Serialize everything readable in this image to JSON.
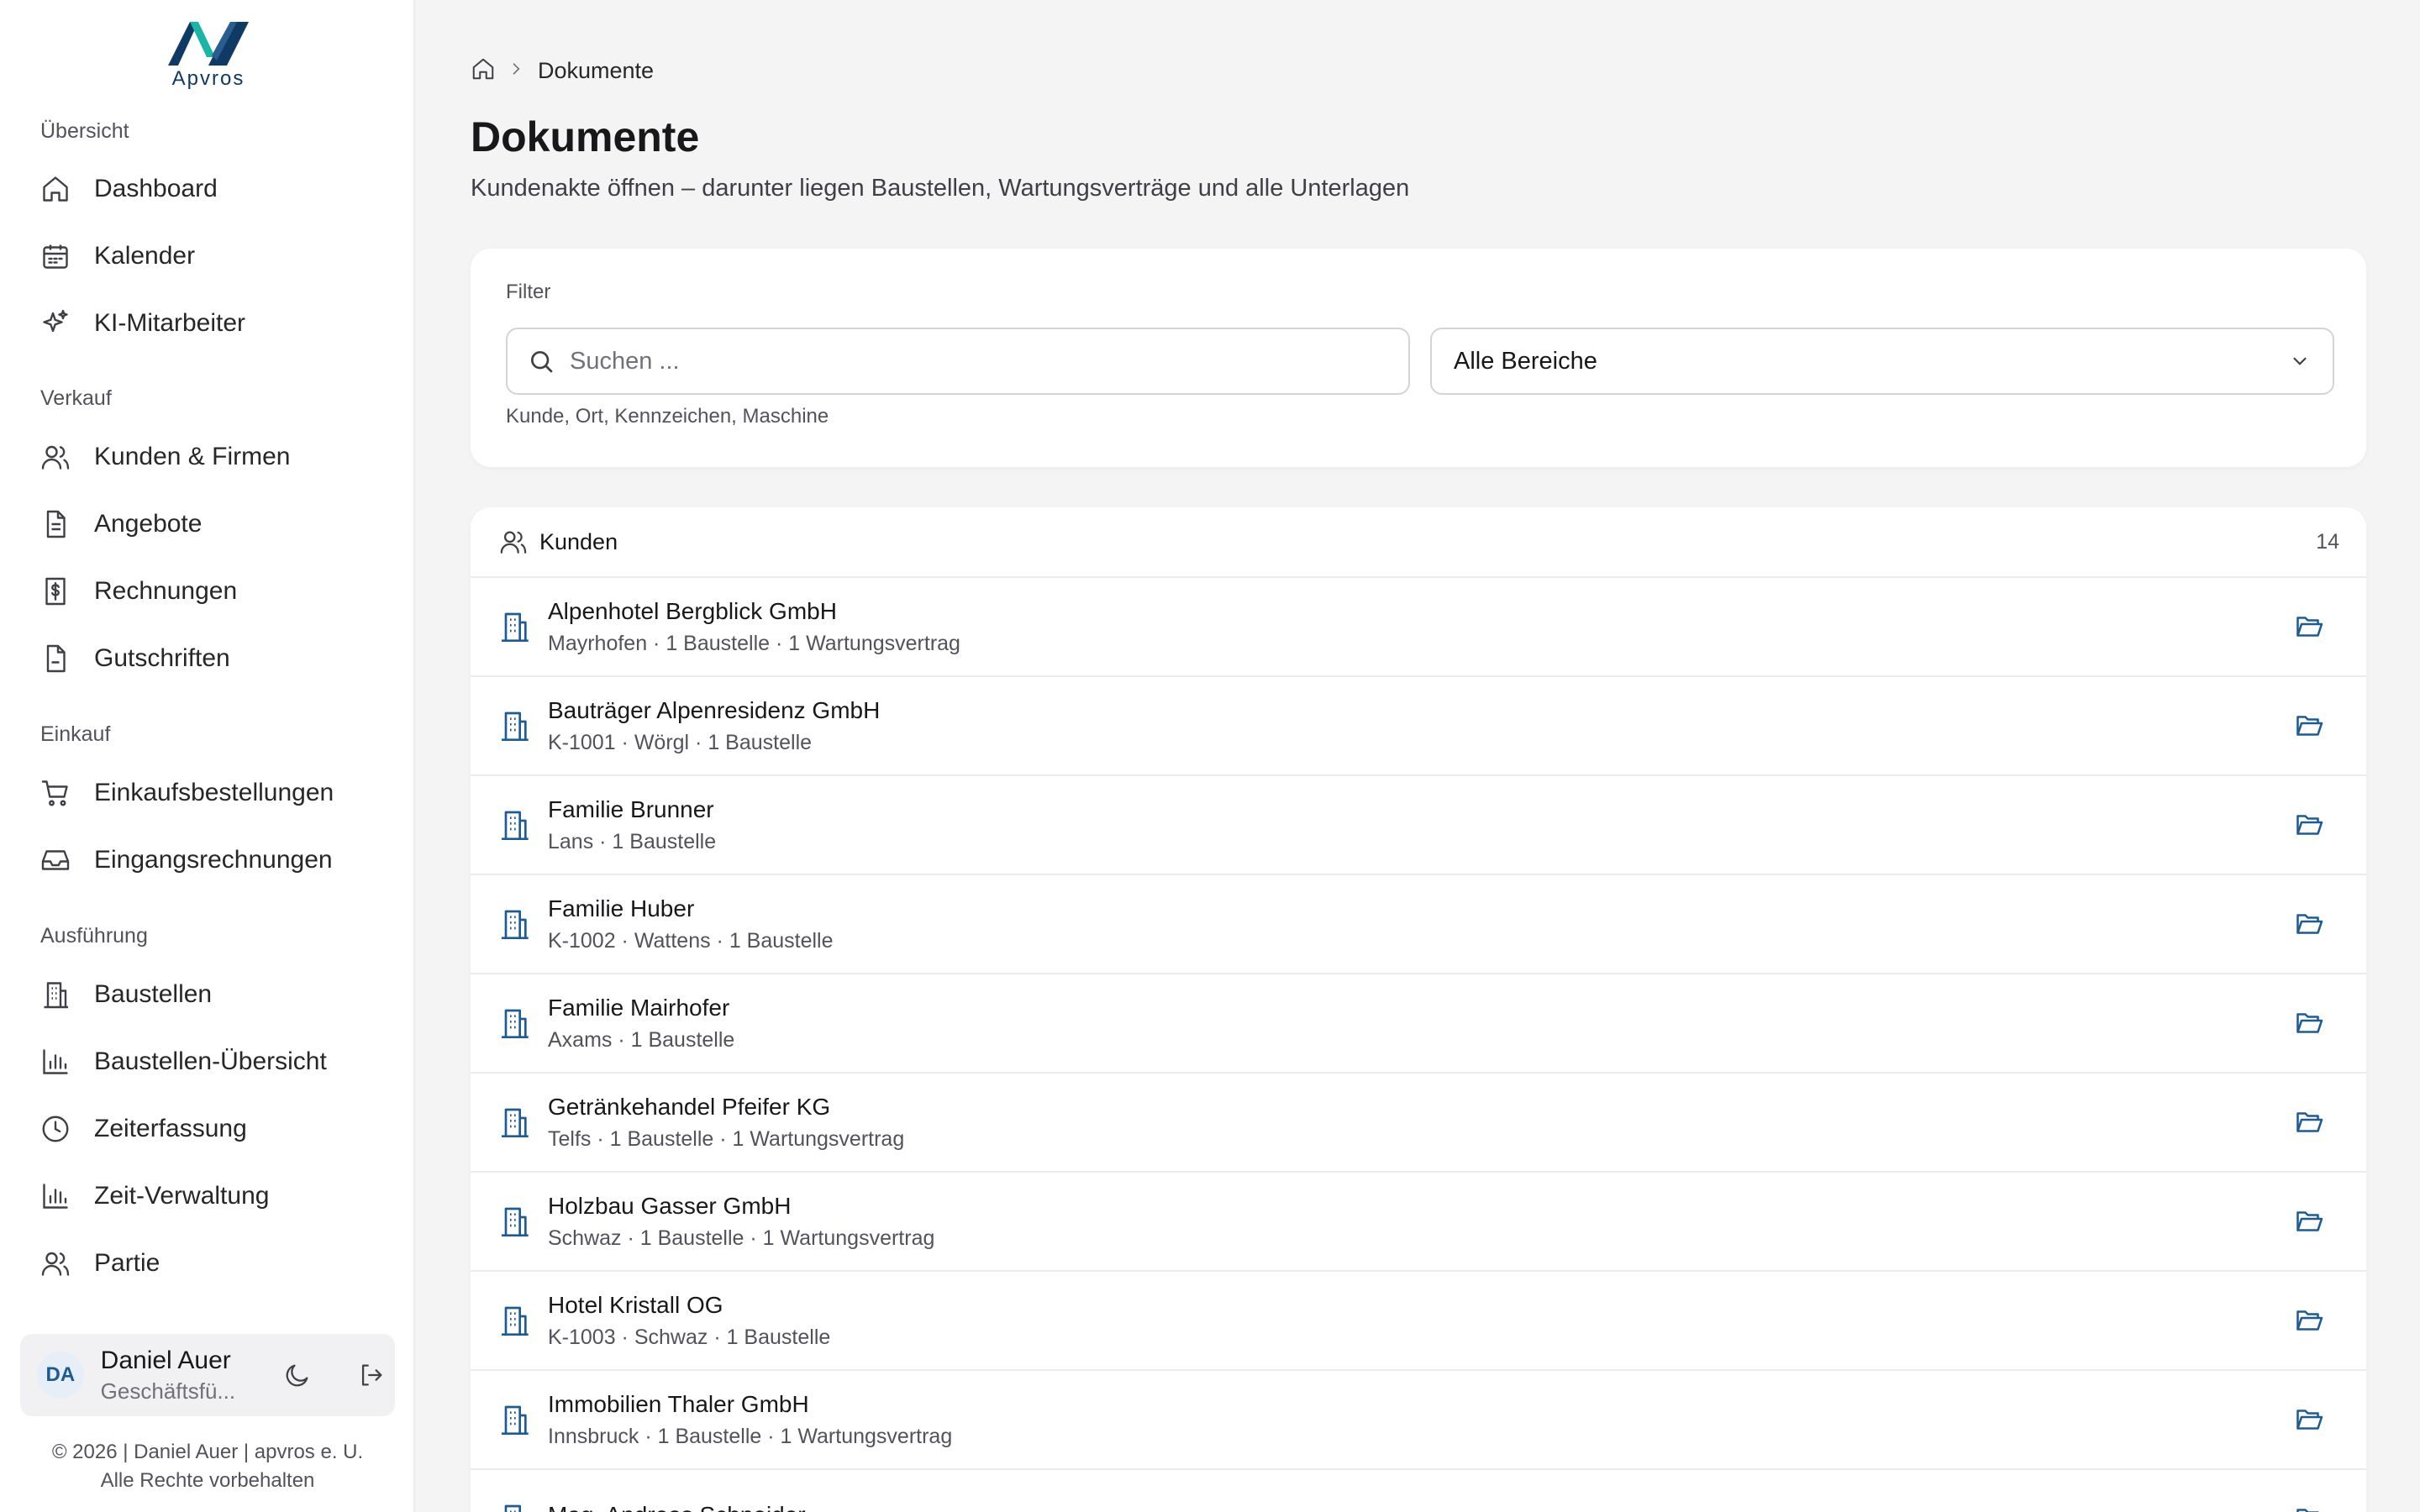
{
  "brand": {
    "logo_text": "Apvros"
  },
  "sidebar": {
    "sections": [
      {
        "title": "Übersicht",
        "items": [
          {
            "label": "Dashboard",
            "icon": "home-icon"
          },
          {
            "label": "Kalender",
            "icon": "calendar-icon"
          },
          {
            "label": "KI-Mitarbeiter",
            "icon": "sparkles-icon"
          }
        ]
      },
      {
        "title": "Verkauf",
        "items": [
          {
            "label": "Kunden & Firmen",
            "icon": "users-icon"
          },
          {
            "label": "Angebote",
            "icon": "document-icon"
          },
          {
            "label": "Rechnungen",
            "icon": "invoice-dollar-icon"
          },
          {
            "label": "Gutschriften",
            "icon": "file-icon"
          }
        ]
      },
      {
        "title": "Einkauf",
        "items": [
          {
            "label": "Einkaufsbestellungen",
            "icon": "cart-icon"
          },
          {
            "label": "Eingangsrechnungen",
            "icon": "inbox-icon"
          }
        ]
      },
      {
        "title": "Ausführung",
        "items": [
          {
            "label": "Baustellen",
            "icon": "building-icon"
          },
          {
            "label": "Baustellen-Übersicht",
            "icon": "bar-chart-icon"
          },
          {
            "label": "Zeiterfassung",
            "icon": "clock-icon"
          },
          {
            "label": "Zeit-Verwaltung",
            "icon": "bar-chart-icon"
          },
          {
            "label": "Partie",
            "icon": "user-group-icon"
          }
        ]
      }
    ]
  },
  "user": {
    "initials": "DA",
    "name": "Daniel Auer",
    "role": "Geschäftsfü..."
  },
  "footer": {
    "line1": "© 2026 | Daniel Auer | apvros e. U.",
    "line2": "Alle Rechte vorbehalten"
  },
  "breadcrumb": {
    "current": "Dokumente"
  },
  "page": {
    "title": "Dokumente",
    "subtitle": "Kundenakte öffnen – darunter liegen Baustellen, Wartungsverträge und alle Unterlagen"
  },
  "filter": {
    "label": "Filter",
    "search_placeholder": "Suchen ...",
    "search_value": "",
    "select_value": "Alle Bereiche",
    "hint": "Kunde, Ort, Kennzeichen, Maschine"
  },
  "customers": {
    "title": "Kunden",
    "count": "14",
    "rows": [
      {
        "name": "Alpenhotel Bergblick GmbH",
        "meta": "Mayrhofen · 1 Baustelle · 1 Wartungsvertrag"
      },
      {
        "name": "Bauträger Alpenresidenz GmbH",
        "meta": "K-1001 · Wörgl · 1 Baustelle"
      },
      {
        "name": "Familie Brunner",
        "meta": "Lans · 1 Baustelle"
      },
      {
        "name": "Familie Huber",
        "meta": "K-1002 · Wattens · 1 Baustelle"
      },
      {
        "name": "Familie Mairhofer",
        "meta": "Axams · 1 Baustelle"
      },
      {
        "name": "Getränkehandel Pfeifer KG",
        "meta": "Telfs · 1 Baustelle · 1 Wartungsvertrag"
      },
      {
        "name": "Holzbau Gasser GmbH",
        "meta": "Schwaz · 1 Baustelle · 1 Wartungsvertrag"
      },
      {
        "name": "Hotel Kristall OG",
        "meta": "K-1003 · Schwaz · 1 Baustelle"
      },
      {
        "name": "Immobilien Thaler GmbH",
        "meta": "Innsbruck · 1 Baustelle · 1 Wartungsvertrag"
      },
      {
        "name": "Mag. Andreas Schneider",
        "meta": ""
      }
    ]
  },
  "colors": {
    "accent": "#1d5b96",
    "logo_teal": "#1bb5a6",
    "logo_navy": "#0f3a64"
  }
}
